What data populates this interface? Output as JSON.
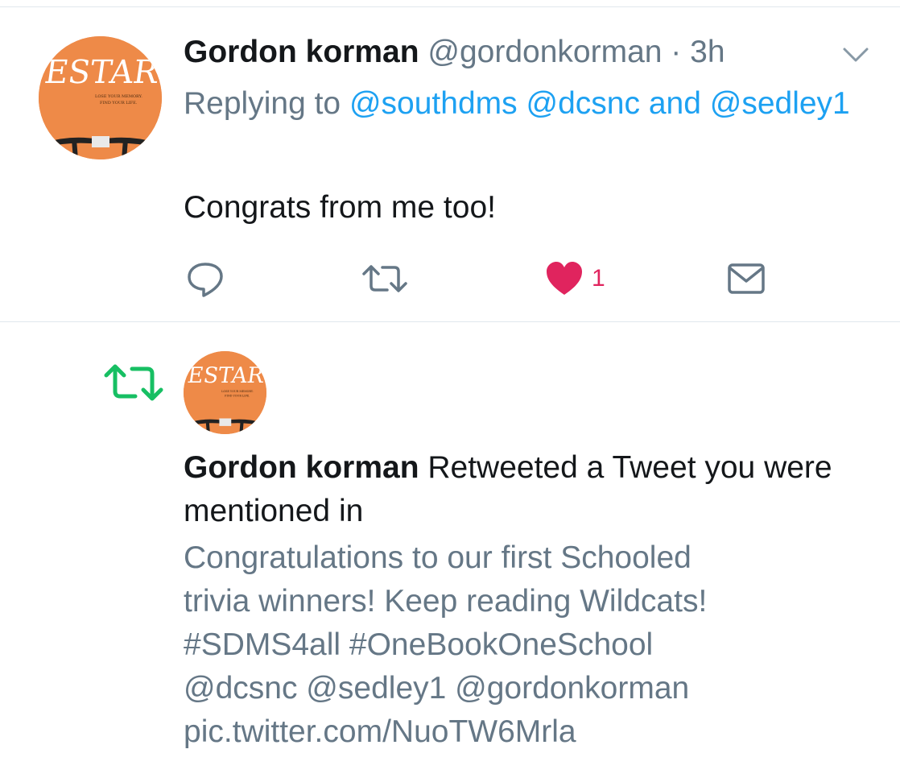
{
  "tweet": {
    "name": "Gordon korman",
    "handle": "@gordonkorman",
    "separator": " · ",
    "time": "3h",
    "replying_prefix": "Replying to ",
    "mention_1": "@southdms",
    "mention_2": "@dcsnc",
    "mention_joiner": "and",
    "mention_3": "@sedley1",
    "body": "Congrats from me too!",
    "like_count": "1"
  },
  "avatar_art": {
    "title_letters": "ESTAR",
    "tagline_1": "LOSE YOUR MEMORY.",
    "tagline_2": "FIND YOUR LIFE."
  },
  "notification": {
    "name": "Gordon korman",
    "action_text": " Retweeted a Tweet you were mentioned in",
    "quoted_lines": [
      "Congratulations to our first Schooled",
      "trivia winners! Keep reading Wildcats!",
      "#SDMS4all #OneBookOneSchool",
      "@dcsnc @sedley1 @gordonkorman",
      "pic.twitter.com/NuoTW6Mrla"
    ]
  },
  "colors": {
    "text": "#14171a",
    "secondary": "#657786",
    "link": "#1da1f2",
    "like": "#e0245e",
    "retweet": "#17bf63",
    "avatar_bg": "#ee8a48"
  },
  "icons": {
    "reply": "reply-icon",
    "retweet": "retweet-icon",
    "like": "heart-icon",
    "dm": "envelope-icon",
    "more": "chevron-down-icon",
    "notification": "retweet-icon"
  }
}
